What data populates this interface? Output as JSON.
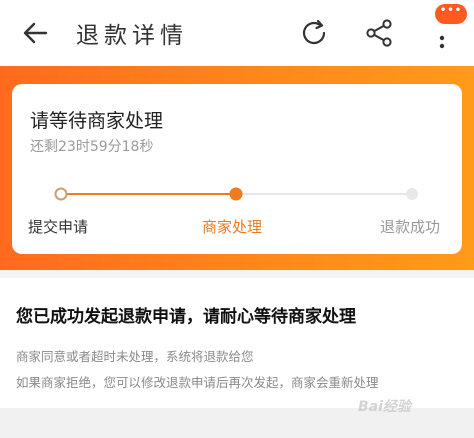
{
  "header": {
    "title": "退款详情",
    "icons": [
      "back-arrow-icon",
      "refresh-icon",
      "share-icon",
      "more-icon"
    ],
    "badge_color": "#ff5a1f"
  },
  "status": {
    "title": "请等待商家处理",
    "countdown": "还剩23时59分18秒",
    "steps": [
      {
        "label": "提交申请",
        "state": "done"
      },
      {
        "label": "商家处理",
        "state": "active"
      },
      {
        "label": "退款成功",
        "state": "pending"
      }
    ],
    "accent_color": "#f07a1e"
  },
  "info": {
    "headline": "您已成功发起退款申请，请耐心等待商家处理",
    "lines": [
      "商家同意或者超时未处理，系统将退款给您",
      "如果商家拒绝，您可以修改退款申请后再次发起，商家会重新处理"
    ]
  },
  "watermark": "Bai经验"
}
